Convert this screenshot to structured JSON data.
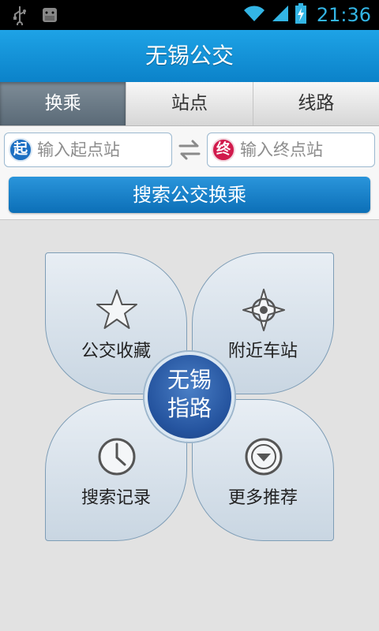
{
  "status_bar": {
    "time": "21:36",
    "icons": [
      "usb-icon",
      "android-debug-icon",
      "wifi-icon",
      "signal-icon",
      "battery-charging-icon"
    ]
  },
  "title_bar": {
    "title": "无锡公交"
  },
  "tabs": [
    {
      "label": "换乘",
      "active": true
    },
    {
      "label": "站点",
      "active": false
    },
    {
      "label": "线路",
      "active": false
    }
  ],
  "search": {
    "start_badge": "起",
    "start_placeholder": "输入起点站",
    "end_badge": "终",
    "end_placeholder": "输入终点站",
    "button": "搜索公交换乘"
  },
  "menu": {
    "items": [
      {
        "label": "公交收藏",
        "icon": "star-icon"
      },
      {
        "label": "附近车站",
        "icon": "compass-icon"
      },
      {
        "label": "搜索记录",
        "icon": "clock-icon"
      },
      {
        "label": "更多推荐",
        "icon": "dropdown-circle-icon"
      }
    ],
    "center_line1": "无锡",
    "center_line2": "指路"
  },
  "colors": {
    "accent": "#0b82c9",
    "status_time": "#33b5e5",
    "start_badge": "#1c6fc2",
    "end_badge": "#d11a4c"
  }
}
